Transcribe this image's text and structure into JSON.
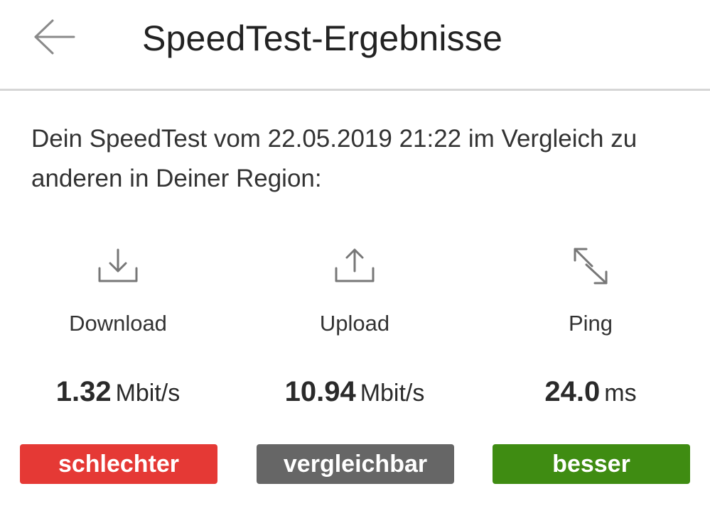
{
  "header": {
    "title": "SpeedTest-Ergebnisse",
    "back_icon": "arrow-left-icon"
  },
  "intro": {
    "text": "Dein SpeedTest vom 22.05.2019 21:22 im Vergleich zu anderen in Deiner Region:"
  },
  "metrics": [
    {
      "icon": "download-icon",
      "label": "Download",
      "value": "1.32",
      "unit": "Mbit/s",
      "rating": "schlechter",
      "rating_color": "#e53935"
    },
    {
      "icon": "upload-icon",
      "label": "Upload",
      "value": "10.94",
      "unit": "Mbit/s",
      "rating": "vergleichbar",
      "rating_color": "#666666"
    },
    {
      "icon": "ping-arrows-icon",
      "label": "Ping",
      "value": "24.0",
      "unit": "ms",
      "rating": "besser",
      "rating_color": "#3f8c12"
    }
  ]
}
